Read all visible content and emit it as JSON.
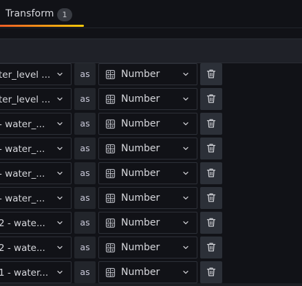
{
  "tabs": {
    "transform": {
      "label": "Transform",
      "badge": "1"
    }
  },
  "conversion_rows": [
    {
      "field": "ter_level ...",
      "as_label": "as",
      "type": "Number"
    },
    {
      "field": "ter_level ...",
      "as_label": "as",
      "type": "Number"
    },
    {
      "field": "- water_...",
      "as_label": "as",
      "type": "Number"
    },
    {
      "field": "- water_...",
      "as_label": "as",
      "type": "Number"
    },
    {
      "field": "- water_...",
      "as_label": "as",
      "type": "Number"
    },
    {
      "field": "- water_...",
      "as_label": "as",
      "type": "Number"
    },
    {
      "field": "2 - wate...",
      "as_label": "as",
      "type": "Number"
    },
    {
      "field": "2 - wate...",
      "as_label": "as",
      "type": "Number"
    },
    {
      "field": "1 - water...",
      "as_label": "as",
      "type": "Number"
    }
  ],
  "icons": {
    "field_chevron": "chevron-down-icon",
    "type_icon": "calculator-icon",
    "type_chevron": "chevron-down-icon",
    "delete": "trash-icon"
  },
  "colors": {
    "background": "#111217",
    "tab_accent_start": "#f05a28",
    "tab_accent_end": "#fbca0a",
    "control_border": "#2e3139",
    "button_bg": "#2c3038"
  }
}
